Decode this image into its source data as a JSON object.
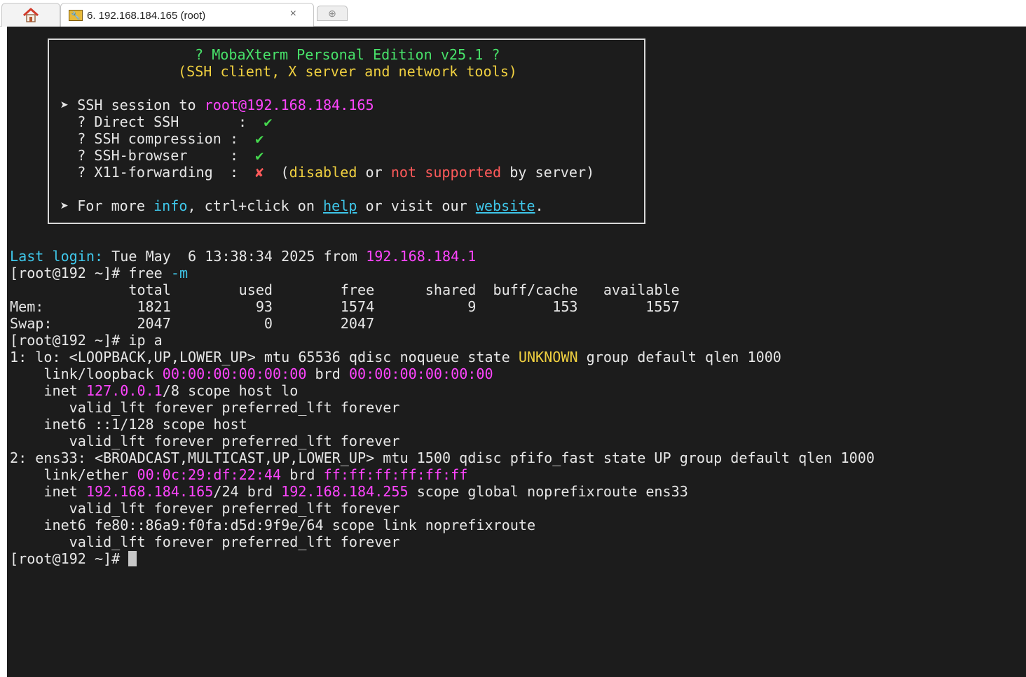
{
  "tabs": {
    "home_icon": "home-icon",
    "session_icon": "wrench-icon",
    "session_label": "6. 192.168.184.165 (root)",
    "close_glyph": "×",
    "new_tab_glyph": "⊕"
  },
  "banner": {
    "title": "? MobaXterm Personal Edition v25.1 ?",
    "subtitle": "(SSH client, X server and network tools)",
    "ssh_prefix": "➤ SSH session to ",
    "ssh_target": "root@192.168.184.165",
    "features": [
      {
        "label": "  ? Direct SSH       :  ",
        "mark": "✔"
      },
      {
        "label": "  ? SSH compression :  ",
        "mark": "✔"
      },
      {
        "label": "  ? SSH-browser     :  ",
        "mark": "✔"
      },
      {
        "label": "  ? X11-forwarding  :  ",
        "mark": "✘"
      }
    ],
    "x11_note": {
      "open": "  (",
      "disabled": "disabled",
      "or": " or ",
      "not_supported": "not supported",
      "by_server": " by server)"
    },
    "more": {
      "prefix": "➤ For more ",
      "info": "info",
      "mid": ", ctrl+click on ",
      "help": "help",
      "or_visit": " or visit our ",
      "website": "website",
      "end": "."
    }
  },
  "terminal": {
    "last_login_label": "Last login:",
    "last_login_text": " Tue May  6 13:38:34 2025 from ",
    "last_login_ip": "192.168.184.1",
    "prompt": "[root@192 ~]# ",
    "cmd_free": "free ",
    "cmd_free_flag": "-m",
    "free_header": "              total        used        free      shared  buff/cache   available",
    "free_mem": "Mem:           1821          93        1574           9         153        1557",
    "free_swap": "Swap:          2047           0        2047",
    "cmd_ip": "ip a",
    "lo_line_a": "1: lo: <LOOPBACK,UP,LOWER_UP> mtu 65536 qdisc noqueue state ",
    "lo_state": "UNKNOWN",
    "lo_line_b": " group default qlen 1000",
    "lo_link_a": "    link/loopback ",
    "lo_mac": "00:00:00:00:00:00",
    "lo_link_b": " brd ",
    "lo_brd": "00:00:00:00:00:00",
    "lo_inet_a": "    inet ",
    "lo_ip": "127.0.0.1",
    "lo_inet_b": "/8 scope host lo",
    "valid_lft": "       valid_lft forever preferred_lft forever",
    "lo_inet6": "    inet6 ::1/128 scope host",
    "ens_line": "2: ens33: <BROADCAST,MULTICAST,UP,LOWER_UP> mtu 1500 qdisc pfifo_fast state UP group default qlen 1000",
    "ens_link_a": "    link/ether ",
    "ens_mac": "00:0c:29:df:22:44",
    "ens_link_b": " brd ",
    "ens_brd": "ff:ff:ff:ff:ff:ff",
    "ens_inet_a": "    inet ",
    "ens_ip": "192.168.184.165",
    "ens_inet_b": "/24 brd ",
    "ens_bcast": "192.168.184.255",
    "ens_inet_c": " scope global noprefixroute ens33",
    "ens_inet6": "    inet6 fe80::86a9:f0fa:d5d:9f9e/64 scope link noprefixroute"
  }
}
